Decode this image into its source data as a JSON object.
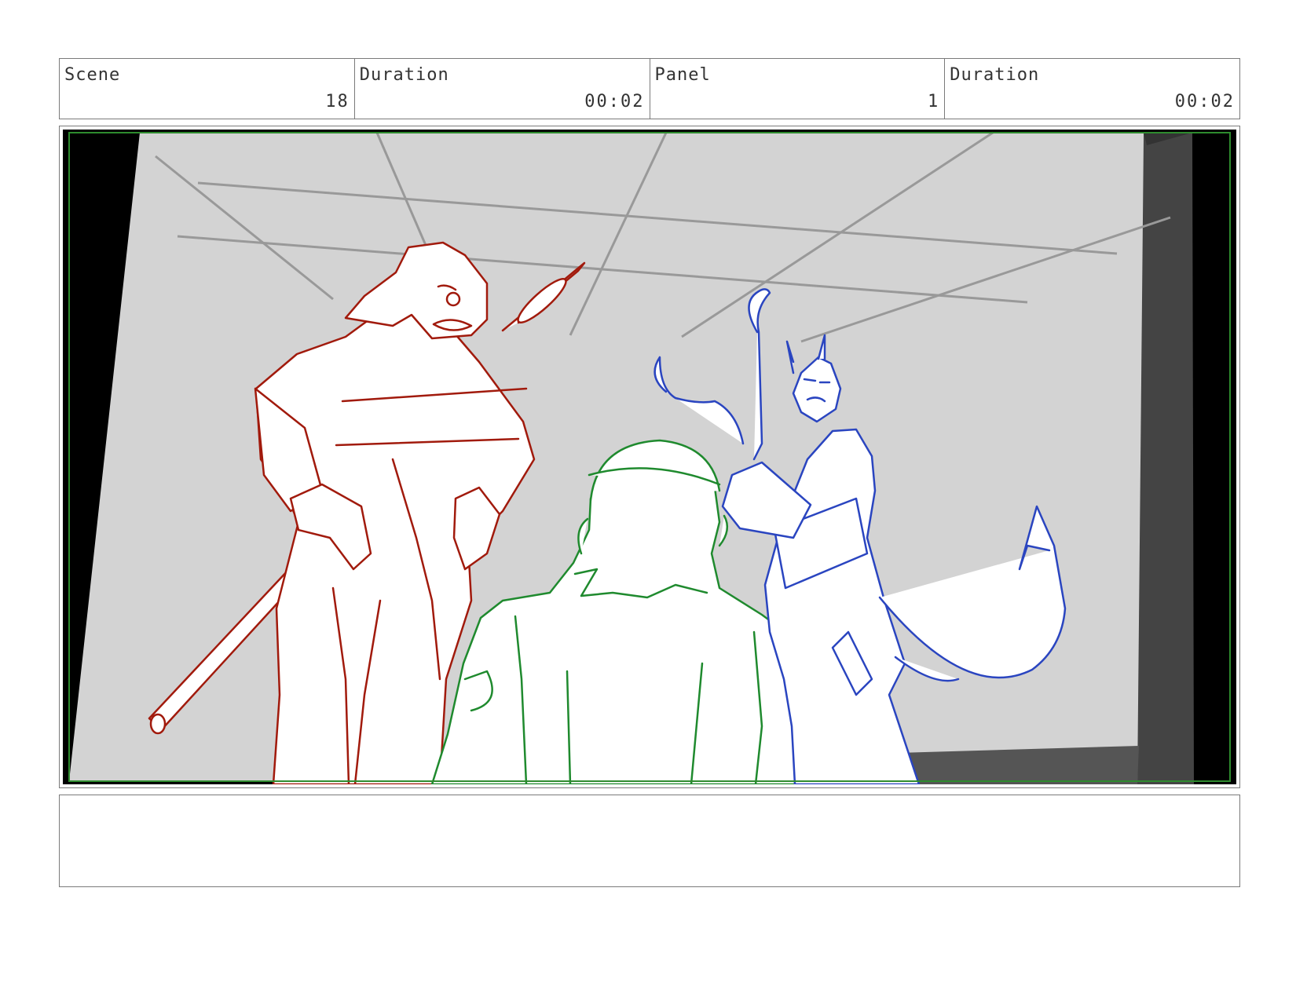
{
  "header": {
    "scene_label": "Scene",
    "scene_value": "18",
    "scene_duration_label": "Duration",
    "scene_duration_value": "00:02",
    "panel_label": "Panel",
    "panel_value": "1",
    "panel_duration_label": "Duration",
    "panel_duration_value": "00:02"
  },
  "notes": {
    "text": ""
  },
  "colors": {
    "red_character": "#a11a0c",
    "green_character": "#1f8a2e",
    "blue_character": "#2a45c0",
    "background_gray": "#d3d3d3",
    "safe_frame": "#2e8b2e"
  }
}
